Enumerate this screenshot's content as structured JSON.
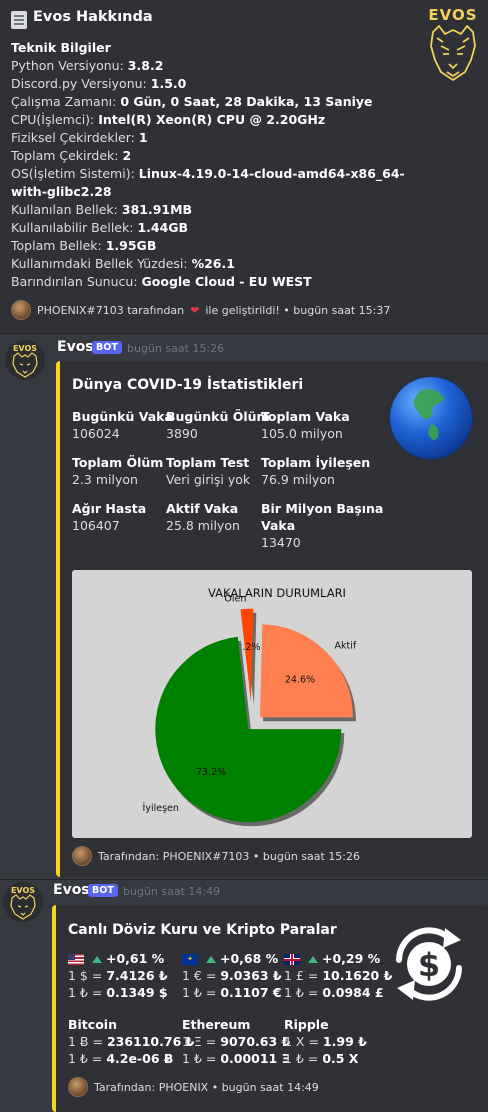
{
  "about": {
    "title": "Evos Hakkında",
    "section": "Teknik Bilgiler",
    "rows": [
      {
        "label": "Python Versiyonu:",
        "value": "3.8.2"
      },
      {
        "label": "Discord.py Versiyonu:",
        "value": "1.5.0"
      },
      {
        "label": "Çalışma Zamanı:",
        "value": "0 Gün, 0 Saat, 28 Dakika, 13 Saniye"
      },
      {
        "label": "CPU(İşlemci):",
        "value": "Intel(R) Xeon(R) CPU @ 2.20GHz"
      },
      {
        "label": "Fiziksel Çekirdekler:",
        "value": "1"
      },
      {
        "label": "Toplam Çekirdek:",
        "value": "2"
      },
      {
        "label": "OS(İşletim Sistemi):",
        "value": "Linux-4.19.0-14-cloud-amd64-x86_64-"
      },
      {
        "label": "",
        "value": "with-glibc2.28"
      },
      {
        "label": "Kullanılan Bellek:",
        "value": "381.91MB"
      },
      {
        "label": "Kullanılabilir Bellek:",
        "value": "1.44GB"
      },
      {
        "label": "Toplam Bellek:",
        "value": "1.95GB"
      },
      {
        "label": "Kullanımdaki Bellek Yüzdesi:",
        "value": "%26.1"
      },
      {
        "label": "Barındırılan Sunucu:",
        "value": "Google Cloud - EU WEST"
      }
    ],
    "footer_prefix": "PHOENIX#7103 tarafından",
    "footer_suffix": "ile geliştirildi! • bugün saat 15:37",
    "logo_text": "EVOS"
  },
  "covid_msg": {
    "username": "Evos",
    "bot_tag": "BOT",
    "timestamp": "bugün saat 15:26",
    "title": "Dünya COVID-19 İstatistikleri",
    "fields": [
      {
        "name": "Bugünkü Vaka",
        "value": "106024"
      },
      {
        "name": "Bugünkü Ölüm",
        "value": "3890"
      },
      {
        "name": "Toplam Vaka",
        "value": "105.0 milyon"
      },
      {
        "name": "Toplam Ölüm",
        "value": "2.3 milyon"
      },
      {
        "name": "Toplam Test",
        "value": "Veri girişi yok"
      },
      {
        "name": "Toplam İyileşen",
        "value": "76.9 milyon"
      },
      {
        "name": "Ağır Hasta",
        "value": "106407"
      },
      {
        "name": "Aktif Vaka",
        "value": "25.8 milyon"
      },
      {
        "name": "Bir Milyon Başına",
        "name2": "Vaka",
        "value": "13470"
      }
    ],
    "footer": "Tarafından: PHOENIX#7103 • bugün saat 15:26"
  },
  "chart_data": {
    "type": "pie",
    "title": "VAKALARIN DURUMLARI",
    "slices": [
      {
        "label": "Aktif",
        "value": 24.6,
        "pct": "24.6%",
        "color": "#ff7f50"
      },
      {
        "label": "Ölen",
        "value": 2.2,
        "pct": "2.2%",
        "color": "#ff4500"
      },
      {
        "label": "İyileşen",
        "value": 73.2,
        "pct": "73.2%",
        "color": "#008000"
      }
    ]
  },
  "fx_msg": {
    "username": "Evos",
    "bot_tag": "BOT",
    "timestamp": "bugün saat 14:49",
    "title": "Canlı Döviz Kuru ve Kripto Paralar",
    "currencies": [
      {
        "change": "+0,61 %",
        "line1_prefix": "1 $ = ",
        "line1_value": "7.4126 ₺",
        "line2_prefix": "1 ₺ = ",
        "line2_value": "0.1349 $"
      },
      {
        "change": "+0,68 %",
        "line1_prefix": "1 € = ",
        "line1_value": "9.0363 ₺",
        "line2_prefix": "1 ₺ = ",
        "line2_value": "0.1107 €"
      },
      {
        "change": "+0,29 %",
        "line1_prefix": "1 £ = ",
        "line1_value": "10.1620 ₺",
        "line2_prefix": "1 ₺ = ",
        "line2_value": "0.0984 £"
      }
    ],
    "crypto": [
      {
        "name": "Bitcoin",
        "line1_prefix": "1 Ƀ = ",
        "line1_value": "236110.76 ₺",
        "line2_prefix": "1 ₺ = ",
        "line2_value": "4.2e-06 Ƀ"
      },
      {
        "name": "Ethereum",
        "line1_prefix": "1 Ξ = ",
        "line1_value": "9070.63 ₺",
        "line2_prefix": "1 ₺ = ",
        "line2_value": "0.00011 Ξ"
      },
      {
        "name": "Ripple",
        "line1_prefix": "1 X = ",
        "line1_value": "1.99 ₺",
        "line2_prefix": "1 ₺ = ",
        "line2_value": "0.5 X"
      }
    ],
    "footer": "Tarafından: PHOENIX • bugün saat 14:49"
  }
}
